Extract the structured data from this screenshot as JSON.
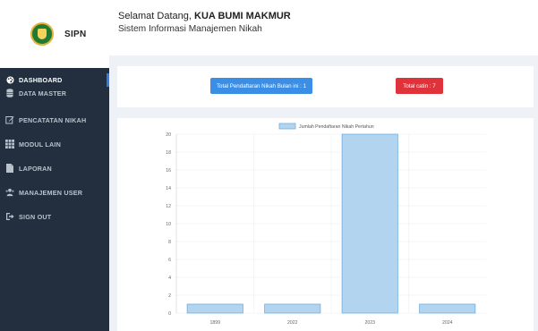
{
  "brand": {
    "name": "SIPN"
  },
  "header": {
    "greeting": "Selamat Datang, ",
    "office": "KUA BUMI MAKMUR",
    "subtitle": "Sistem Informasi Manajemen Nikah"
  },
  "sidebar": {
    "items": [
      {
        "label": "DASHBOARD",
        "icon": "palette-icon",
        "active": true
      },
      {
        "label": "DATA MASTER",
        "icon": "database-icon",
        "active": false
      },
      {
        "label": "PENCATATAN NIKAH",
        "icon": "edit-icon",
        "active": false
      },
      {
        "label": "MODUL LAIN",
        "icon": "grid-icon",
        "active": false
      },
      {
        "label": "LAPORAN",
        "icon": "file-icon",
        "active": false
      },
      {
        "label": "MANAJEMEN USER",
        "icon": "users-icon",
        "active": false
      },
      {
        "label": "SIGN OUT",
        "icon": "sign-out-icon",
        "active": false
      }
    ]
  },
  "stats": {
    "monthly_registrations": "Total Pendaftaran Nikah Bulan ini : 1",
    "total_catin": "Total catin : 7"
  },
  "colors": {
    "sidebar": "#232f3e",
    "accent_blue": "#3a8ee6",
    "accent_red": "#e0323b",
    "bar_fill": "#b3d4ee",
    "bar_stroke": "#6eaee0"
  },
  "chart_data": {
    "type": "bar",
    "categories": [
      "1899",
      "2022",
      "2023",
      "2024"
    ],
    "series": [
      {
        "name": "Jumlah Pendaftaran Nikah Pertahun",
        "values": [
          1,
          1,
          20,
          1
        ]
      }
    ],
    "ylim": [
      0,
      20
    ],
    "yticks": [
      0,
      2,
      4,
      6,
      8,
      10,
      12,
      14,
      16,
      18,
      20
    ],
    "grid": true,
    "legend": "top-center"
  }
}
